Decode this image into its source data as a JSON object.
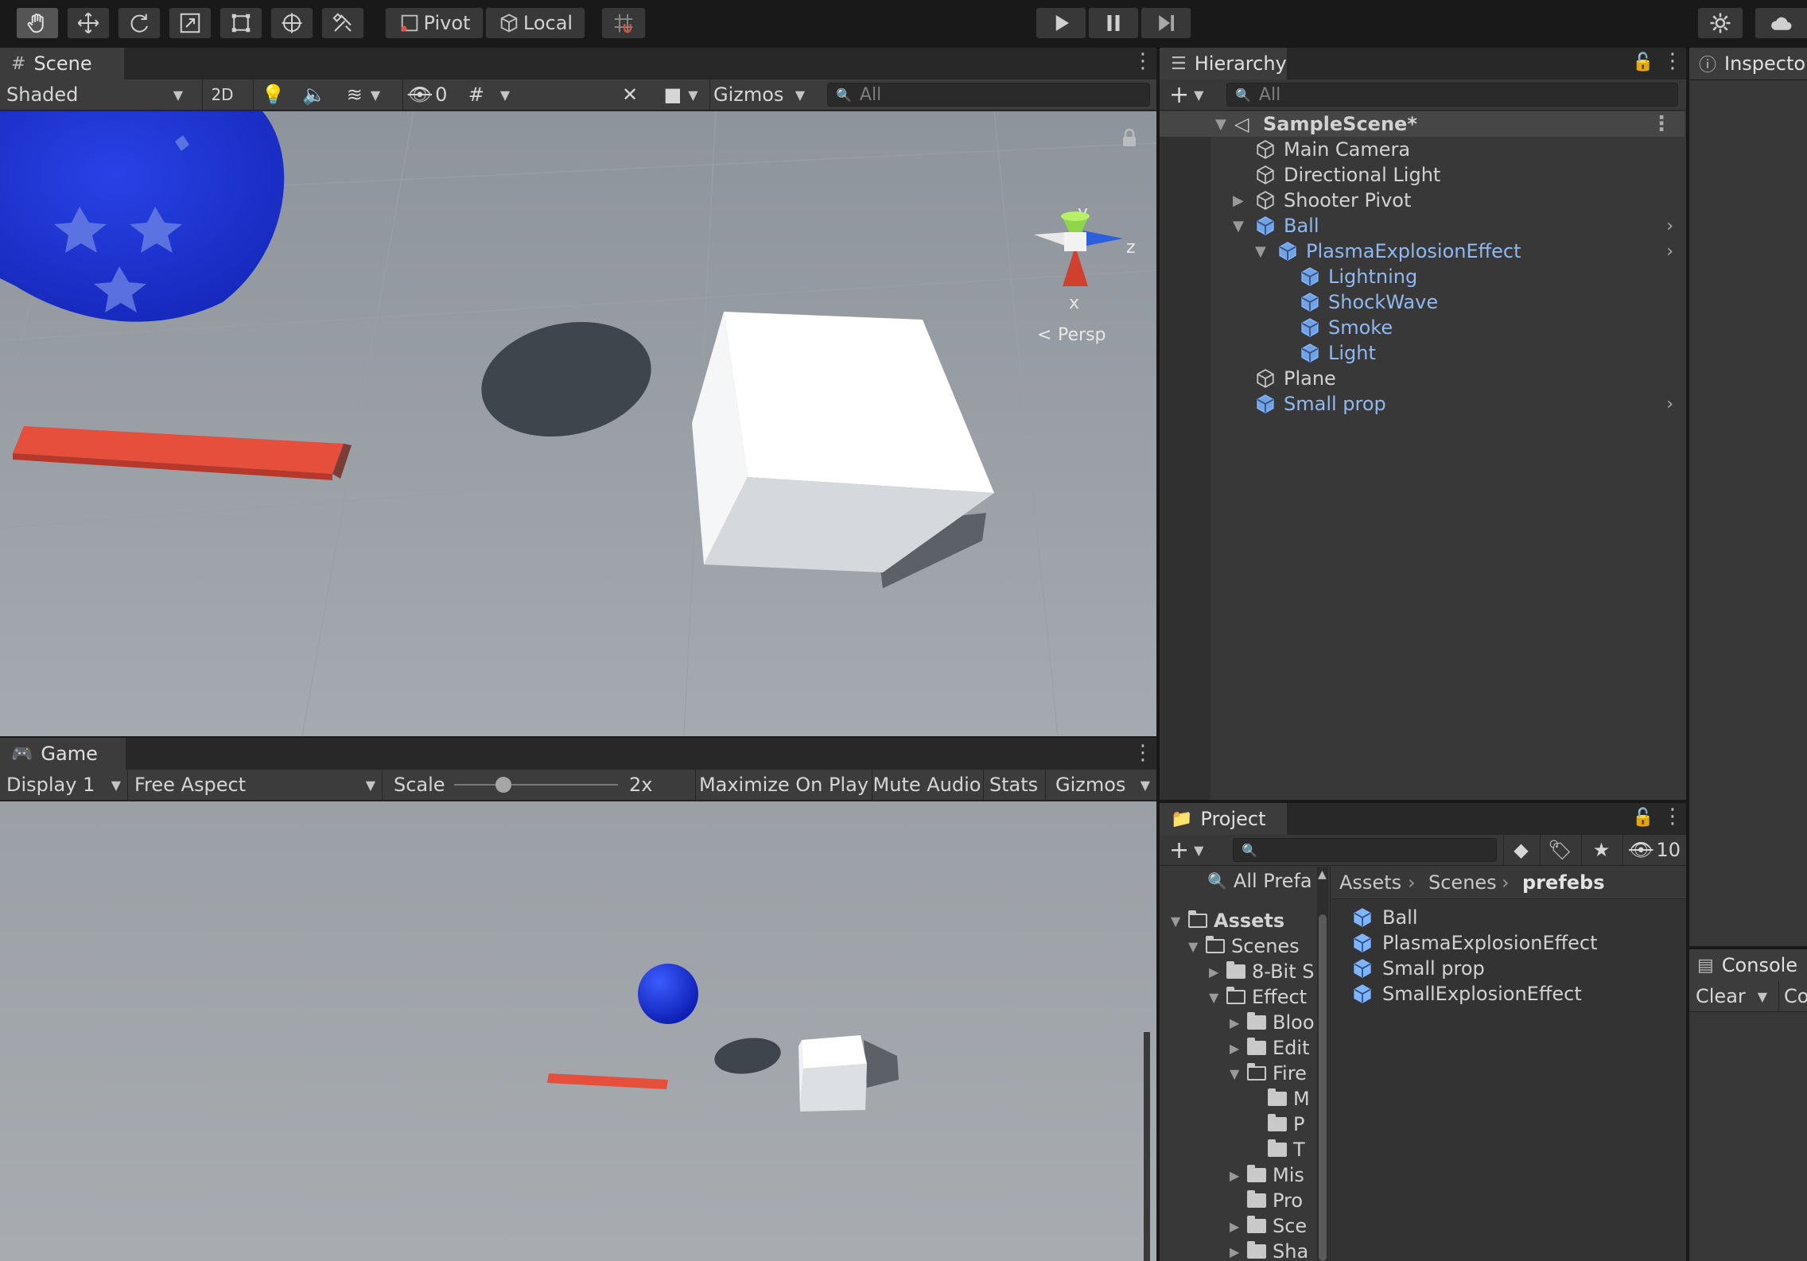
{
  "toolbar": {
    "tools": [
      "hand-icon",
      "move-icon",
      "rotate-icon",
      "scale-icon",
      "rect-icon",
      "transform-icon",
      "custom-tool-icon"
    ],
    "pivot_label": "Pivot",
    "local_label": "Local",
    "play_controls": [
      "play-icon",
      "pause-icon",
      "step-icon"
    ]
  },
  "scene": {
    "tab_label": "Scene",
    "shading": "Shaded",
    "mode_2d": "2D",
    "hidden_count": "0",
    "gizmos_label": "Gizmos",
    "search_placeholder": "All",
    "gizmo_axes": {
      "y": "y",
      "x": "x",
      "z": "z"
    },
    "projection": "Persp"
  },
  "game": {
    "tab_label": "Game",
    "display": "Display 1",
    "aspect": "Free Aspect",
    "scale_label": "Scale",
    "scale_value": "2x",
    "scale_slider_fraction": 0.3,
    "maximize": "Maximize On Play",
    "mute": "Mute Audio",
    "stats": "Stats",
    "gizmos": "Gizmos"
  },
  "hierarchy": {
    "tab_label": "Hierarchy",
    "search_placeholder": "All",
    "scene_name": "SampleScene*",
    "items": [
      {
        "label": "Main Camera",
        "prefab": false
      },
      {
        "label": "Directional Light",
        "prefab": false
      },
      {
        "label": "Shooter Pivot",
        "prefab": false
      },
      {
        "label": "Ball",
        "prefab": true
      },
      {
        "label": "PlasmaExplosionEffect",
        "prefab": true
      },
      {
        "label": "Lightning",
        "prefab": true
      },
      {
        "label": "ShockWave",
        "prefab": true
      },
      {
        "label": "Smoke",
        "prefab": true
      },
      {
        "label": "Light",
        "prefab": true
      },
      {
        "label": "Plane",
        "prefab": false
      },
      {
        "label": "Small prop",
        "prefab": true
      }
    ]
  },
  "inspector": {
    "tab_label": "Inspector"
  },
  "console": {
    "tab_label": "Console",
    "clear_label": "Clear",
    "collapse_label": "Co"
  },
  "project": {
    "tab_label": "Project",
    "hidden_count": "10",
    "all_prefabs": "All Prefa",
    "breadcrumb": [
      "Assets",
      "Scenes",
      "prefebs"
    ],
    "tree": [
      {
        "label": "Assets"
      },
      {
        "label": "Scenes"
      },
      {
        "label": "8-Bit S"
      },
      {
        "label": "Effect"
      },
      {
        "label": "Bloo"
      },
      {
        "label": "Edit"
      },
      {
        "label": "Fire"
      },
      {
        "label": "M"
      },
      {
        "label": "P"
      },
      {
        "label": "T"
      },
      {
        "label": "Mis"
      },
      {
        "label": "Pro"
      },
      {
        "label": "Sce"
      },
      {
        "label": "Sha"
      }
    ],
    "assets": [
      "Ball",
      "PlasmaExplosionEffect",
      "Small prop",
      "SmallExplosionEffect"
    ]
  }
}
